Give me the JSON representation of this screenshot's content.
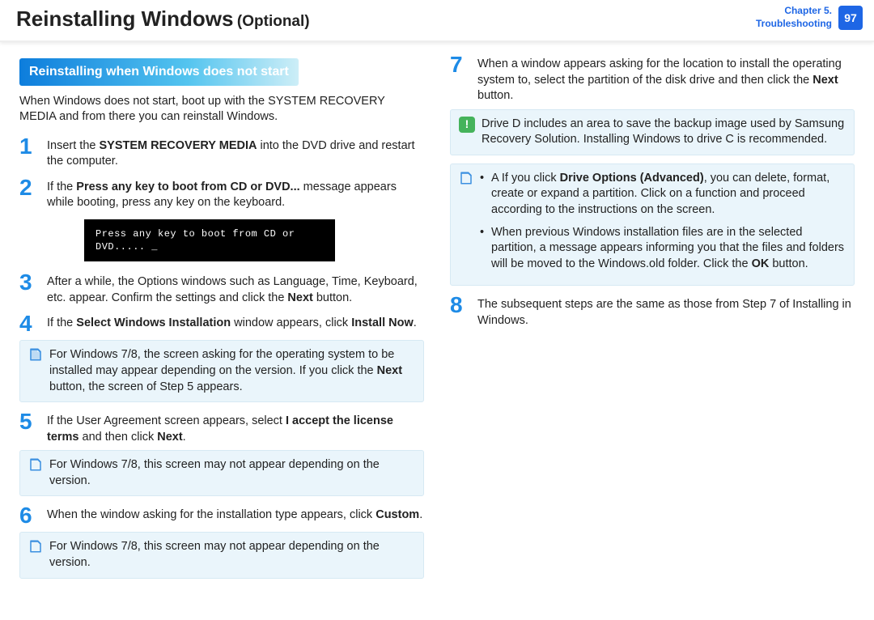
{
  "header": {
    "title_main": "Reinstalling Windows",
    "title_sub": "(Optional)",
    "chapter_line": "Chapter 5.",
    "section_line": "Troubleshooting",
    "page_number": "97"
  },
  "section_heading": "Reinstalling when Windows does not start",
  "intro": "When Windows does not start, boot up with the SYSTEM RECOVERY MEDIA and from there you can reinstall Windows.",
  "boot_text": "Press any key to boot from CD or DVD..... _",
  "steps": {
    "s1": {
      "num": "1",
      "pre": "Insert the ",
      "bold": "SYSTEM RECOVERY MEDIA",
      "post": " into the DVD drive and restart the computer."
    },
    "s2": {
      "num": "2",
      "pre": "If the ",
      "bold": "Press any key to boot from CD or DVD...",
      "post": " message appears while booting, press any key on the keyboard."
    },
    "s3": {
      "num": "3",
      "pre": "After a while, the Options windows such as Language, Time, Keyboard, etc. appear. Confirm the settings and click the ",
      "bold": "Next",
      "post": " button."
    },
    "s4": {
      "num": "4",
      "pre": "If the ",
      "bold": "Select Windows Installation",
      "mid": " window appears, click ",
      "bold2": "Install Now",
      "post": "."
    },
    "s5": {
      "num": "5",
      "pre": "If the User Agreement screen appears, select ",
      "bold": "I accept the license terms",
      "mid": " and then click ",
      "bold2": "Next",
      "post": "."
    },
    "s6": {
      "num": "6",
      "pre": "When the window asking for the installation type appears, click ",
      "bold": "Custom",
      "post": "."
    },
    "s7": {
      "num": "7",
      "pre": "When a window appears asking for the location to install the operating system to, select the partition of the disk drive and then click the ",
      "bold": "Next",
      "post": " button."
    },
    "s8": {
      "num": "8",
      "text": "The subsequent steps are the same as those from Step 7 of Installing in Windows."
    }
  },
  "notes": {
    "n4": {
      "pre": "For Windows 7/8, the screen asking for the operating system to be installed may appear depending on the version. If you click the ",
      "bold": "Next",
      "post": " button, the screen of Step 5 appears."
    },
    "n5b": "For Windows 7/8, this screen may not appear depending on the version.",
    "n6b": "For Windows 7/8, this screen may not appear depending on the version.",
    "warn7": "Drive D includes an area to save the backup image used by Samsung Recovery Solution. Installing Windows to drive C is recommended.",
    "bul1": {
      "pre": "A If you click ",
      "bold": "Drive Options (Advanced)",
      "post": ", you can delete, format, create or expand a partition. Click on a function and proceed according to the instructions on the screen."
    },
    "bul2": {
      "pre": "When previous Windows installation files are in the selected partition, a message appears informing you that the files and folders will be moved to the Windows.old folder. Click the ",
      "bold": "OK",
      "post": " button."
    }
  }
}
